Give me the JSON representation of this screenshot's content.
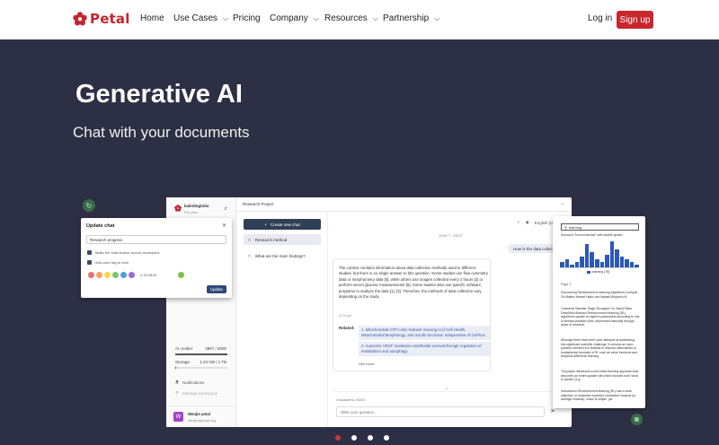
{
  "brand": {
    "name": "Petal",
    "color": "#c2262e"
  },
  "nav": {
    "items": [
      {
        "label": "Home",
        "dropdown": false
      },
      {
        "label": "Use Cases",
        "dropdown": true
      },
      {
        "label": "Pricing",
        "dropdown": false
      },
      {
        "label": "Company",
        "dropdown": true
      },
      {
        "label": "Resources",
        "dropdown": true
      },
      {
        "label": "Partnership",
        "dropdown": true
      }
    ],
    "login": "Log in",
    "signup": "Sign up"
  },
  "hero": {
    "title": "Generative AI",
    "subtitle": "Chat with your documents"
  },
  "app": {
    "workspace": {
      "name": "kaleidoglobe",
      "plan": "Pro plan"
    },
    "project_title": "Research Project",
    "sidebar": {
      "ai_credits_label": "AI credits:",
      "ai_credits_value": "4997 / 5000",
      "ai_credits_fraction": 0.999,
      "storage_label": "Storage:",
      "storage_value": "1.43 GB / 1 TB",
      "storage_fraction": 0.02,
      "notifications": "Notifications",
      "manage_workspace": "Manage workspace"
    },
    "user": {
      "initial": "W",
      "name": "Wenjie petal",
      "email": "wenjie@petal.org"
    },
    "new_chat": "Create new chat",
    "chats": [
      "Research method",
      "What are the main findings?"
    ],
    "language": "English (US)",
    "date": "June 7, 2023",
    "user_message": "How is the data collected?",
    "answer": {
      "text": "The context contains information about data collection methods used in different studies, but there is no single answer to this question. Some studies use flow cytometry data or morphometry data [6], while others use images collected every 2 hours [2] or perform serum glucose measurements [5]. Some studies also use specific software programs to analyze the data [1], [3]. Therefore, the methods of data collection vary depending on the study.",
      "time": "5:05 pm",
      "related_label": "Related:",
      "related": [
        "1. Mitochondrial CTP Links Nutrient Sensing to β-Cell Health, Mitochondrial Morphology, and Insulin Secretion Independent of OxPhos",
        "2. Autocrine VEGF maintains endothelial survival through regulation of metabolism and autophagy"
      ],
      "see_more": "See more"
    },
    "characters": "Characters: 0/400",
    "input_placeholder": "Write your question..."
  },
  "modal": {
    "title": "Update chat",
    "input_value": "Research progress",
    "option1": "Make the chat shared across workspace",
    "option2": "Add color tag to chat",
    "colors": [
      "#e57373",
      "#f4a261",
      "#f2d94e",
      "#7cc46b",
      "#4f9ed9",
      "#9b6cd6"
    ],
    "hex": "# 3D9B3D",
    "selected_color": "#7cc142",
    "button": "Update"
  },
  "doc": {
    "search": "learning",
    "found": "Surround \"found matches\" with double quotes",
    "histogram": [
      2,
      3,
      1,
      2,
      4,
      9,
      6,
      3,
      2,
      5,
      10,
      7,
      4,
      3,
      2,
      1
    ],
    "legend": "learning (78)",
    "page": "Page 1",
    "paras": [
      "Discovering Reinforcement Learning Algorithms Junhyuk Oh Matteo Hessel Hado van Hasselt Wojciech M.",
      "Czarnecki Satinder Singh Zhongwen Xu David Silver DeepMind Abstract Reinforcement learning (RL) algorithms update an agent's parameters according to one of several possible rules, discovered manually through years of research.",
      "Although there have been prior attempts at addressing this significant scientific challenge, it remains an open question whether it is feasible to discover alternatives to fundamental concepts of RL such as value functions and temporal-difference learning.",
      "This paper introduces a new meta-learning approach that discovers an entire update rule which includes both 'what to predict' (e.g.",
      "Introduction Reinforcement learning (RL) has a clear objective: to maximise expected cumulative rewards (or average rewards), which is simple, yet"
    ]
  },
  "carousel": {
    "count": 4,
    "active": 0
  }
}
